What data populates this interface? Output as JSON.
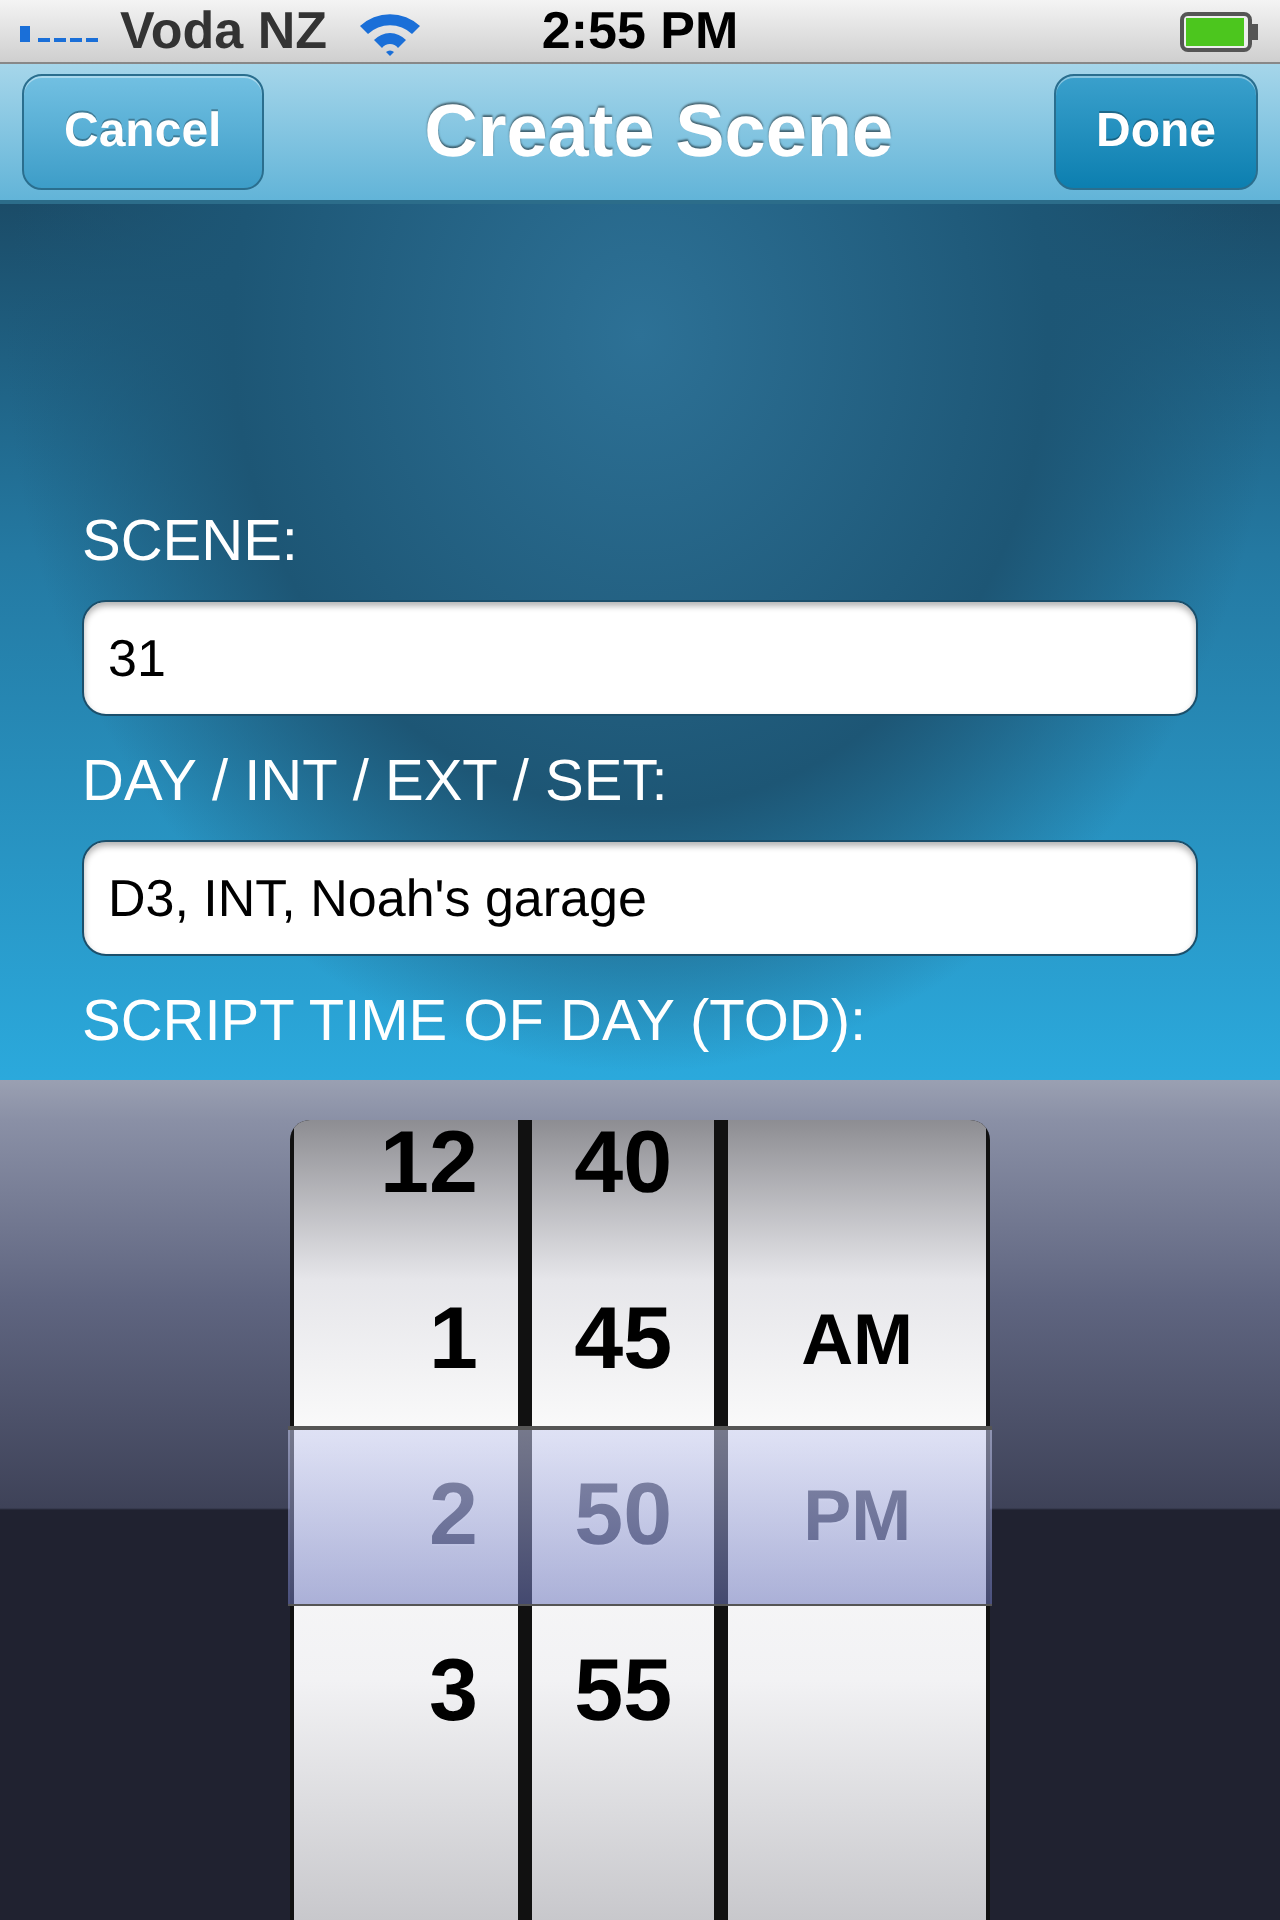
{
  "status_bar": {
    "carrier": "Voda NZ",
    "time": "2:55 PM"
  },
  "nav_bar": {
    "title": "Create Scene",
    "left_button": "Cancel",
    "right_button": "Done"
  },
  "form": {
    "fields": [
      {
        "label": "SCENE:",
        "value": "31"
      },
      {
        "label": "DAY / INT / EXT / SET:",
        "value": "D3, INT, Noah's garage"
      }
    ],
    "time_label": "SCRIPT TIME OF DAY (TOD):"
  },
  "time_picker": {
    "columns": [
      {
        "kind": "hour",
        "items": [
          {
            "label": "12",
            "selected": false
          },
          {
            "label": "1",
            "selected": false
          },
          {
            "label": "2",
            "selected": true
          },
          {
            "label": "3",
            "selected": false
          }
        ]
      },
      {
        "kind": "minute",
        "items": [
          {
            "label": "40",
            "selected": false
          },
          {
            "label": "45",
            "selected": false
          },
          {
            "label": "50",
            "selected": true
          },
          {
            "label": "55",
            "selected": false
          }
        ]
      },
      {
        "kind": "period",
        "items": [
          {
            "label": "AM",
            "selected": false
          },
          {
            "label": "PM",
            "selected": true
          }
        ]
      }
    ]
  }
}
